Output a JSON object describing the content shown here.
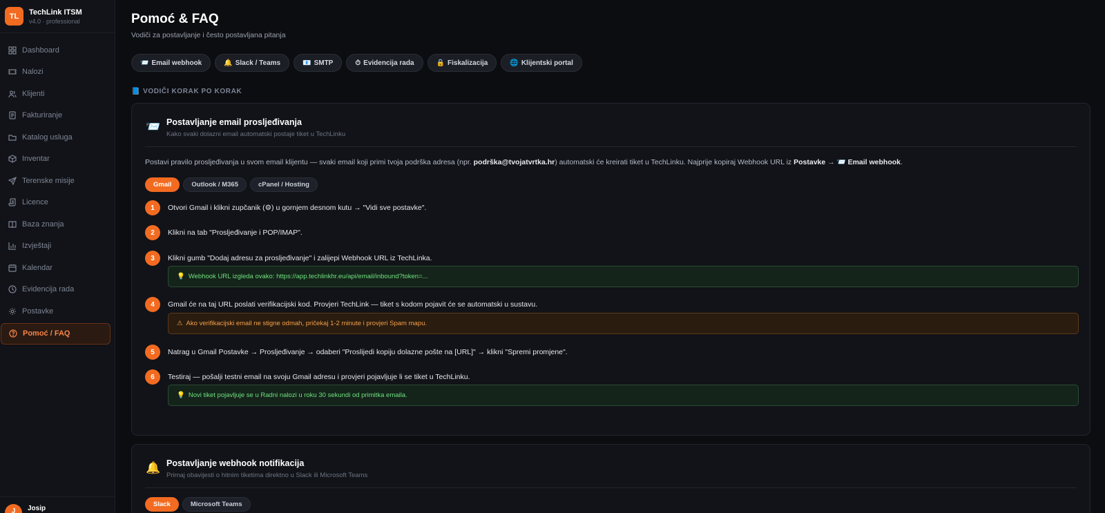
{
  "brand": {
    "initials": "TL",
    "name": "TechLink ITSM",
    "version": "v4.0 · professional"
  },
  "sidebar": {
    "items": [
      {
        "label": "Dashboard",
        "icon": "grid-icon"
      },
      {
        "label": "Nalozi",
        "icon": "ticket-icon"
      },
      {
        "label": "Klijenti",
        "icon": "users-icon"
      },
      {
        "label": "Fakturiranje",
        "icon": "invoice-icon"
      },
      {
        "label": "Katalog usluga",
        "icon": "folder-icon"
      },
      {
        "label": "Inventar",
        "icon": "box-icon"
      },
      {
        "label": "Terenske misije",
        "icon": "send-icon"
      },
      {
        "label": "Licence",
        "icon": "scroll-icon"
      },
      {
        "label": "Baza znanja",
        "icon": "book-icon"
      },
      {
        "label": "Izvještaji",
        "icon": "bar-chart-icon"
      },
      {
        "label": "Kalendar",
        "icon": "calendar-icon"
      },
      {
        "label": "Evidencija rada",
        "icon": "clock-icon"
      },
      {
        "label": "Postavke",
        "icon": "gear-icon"
      },
      {
        "label": "Pomoć / FAQ",
        "icon": "help-circle-icon",
        "active": true
      }
    ]
  },
  "user": {
    "name": "Josip",
    "initial": "J"
  },
  "page": {
    "title": "Pomoć & FAQ",
    "subtitle": "Vodiči za postavljanje i često postavljana pitanja"
  },
  "quicklinks": [
    {
      "emoji": "📨",
      "label": "Email webhook"
    },
    {
      "emoji": "🔔",
      "label": "Slack / Teams"
    },
    {
      "emoji": "📧",
      "label": "SMTP"
    },
    {
      "emoji": "⏱",
      "label": "Evidencija rada"
    },
    {
      "emoji": "🔒",
      "label": "Fiskalizacija"
    },
    {
      "emoji": "🌐",
      "label": "Klijentski portal"
    }
  ],
  "section": {
    "emoji": "📘",
    "label": "VODIČI KORAK PO KORAK"
  },
  "guide1": {
    "emoji": "📨",
    "title": "Postavljanje email prosljeđivanja",
    "subtitle": "Kako svaki dolazni email automatski postaje tiket u TechLinku",
    "intro": {
      "a": "Postavi pravilo prosljeđivanja u svom email klijentu — svaki email koji primi tvoja podrška adresa (npr. ",
      "b": "podrška@tvojatvrtka.hr",
      "c": ") automatski će kreirati tiket u TechLinku. Najprije kopiraj Webhook URL iz ",
      "d": "Postavke",
      "e": " → 📨 ",
      "f": "Email webhook",
      "g": "."
    },
    "tabs": [
      "Gmail",
      "Outlook / M365",
      "cPanel / Hosting"
    ],
    "steps": [
      {
        "n": "1",
        "text": "Otvori Gmail i klikni zupčanik (⚙) u gornjem desnom kutu → \"Vidi sve postavke\"."
      },
      {
        "n": "2",
        "text": "Klikni na tab \"Prosljeđivanje i POP/IMAP\"."
      },
      {
        "n": "3",
        "text": "Klikni gumb \"Dodaj adresu za prosljeđivanje\" i zalijepi Webhook URL iz TechLinka."
      },
      {
        "n": "4",
        "text": "Gmail će na taj URL poslati verifikacijski kod. Provjeri TechLink — tiket s kodom pojavit će se automatski u sustavu."
      },
      {
        "n": "5",
        "text": "Natrag u Gmail Postavke → Prosljeđivanje → odaberi \"Proslijedi kopiju dolazne pošte na [URL]\" → klikni \"Spremi promjene\"."
      },
      {
        "n": "6",
        "text": "Testiraj — pošalji testni email na svoju Gmail adresu i provjeri pojavljuje li se tiket u TechLinku."
      }
    ],
    "tips": {
      "t3": {
        "emoji": "💡",
        "text": "Webhook URL izgleda ovako: https://app.techlinkhr.eu/api/email/inbound?token=..."
      },
      "t4": {
        "emoji": "⚠",
        "text": "Ako verifikacijski email ne stigne odmah, pričekaj 1-2 minute i provjeri Spam mapu."
      },
      "t6": {
        "emoji": "💡",
        "text": "Novi tiket pojavljuje se u Radni nalozi u roku 30 sekundi od primitka emaila."
      }
    }
  },
  "guide2": {
    "emoji": "🔔",
    "title": "Postavljanje webhook notifikacija",
    "subtitle": "Primaj obavijesti o hitnim tiketima direktno u Slack ili Microsoft Teams",
    "tabs": [
      "Slack",
      "Microsoft Teams"
    ]
  }
}
